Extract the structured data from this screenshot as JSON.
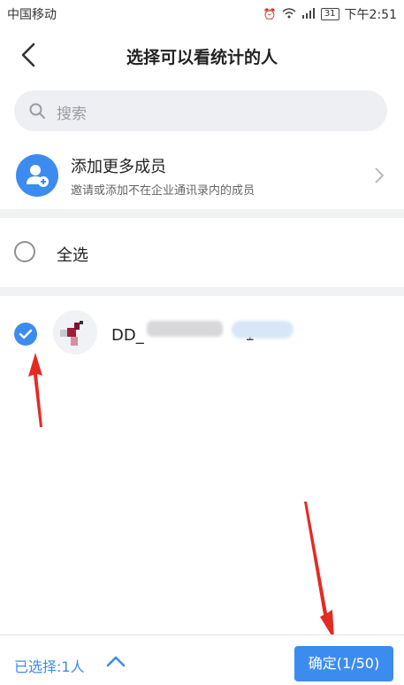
{
  "status_bar": {
    "carrier": "中国移动",
    "battery": "31",
    "time": "下午2:51"
  },
  "header": {
    "title": "选择可以看统计的人"
  },
  "search": {
    "placeholder": "搜索"
  },
  "add_members": {
    "title": "添加更多成员",
    "subtitle": "邀请或添加不在企业通讯录内的成员"
  },
  "select_all": {
    "label": "全选",
    "checked": false
  },
  "members": [
    {
      "name_visible": "DD_",
      "name_suffix": "1",
      "checked": true
    }
  ],
  "footer": {
    "selected_label": "已选择:1人",
    "confirm_label": "确定(1/50)"
  },
  "colors": {
    "accent": "#3c8cf0",
    "annotation_arrow": "#e32b22"
  }
}
